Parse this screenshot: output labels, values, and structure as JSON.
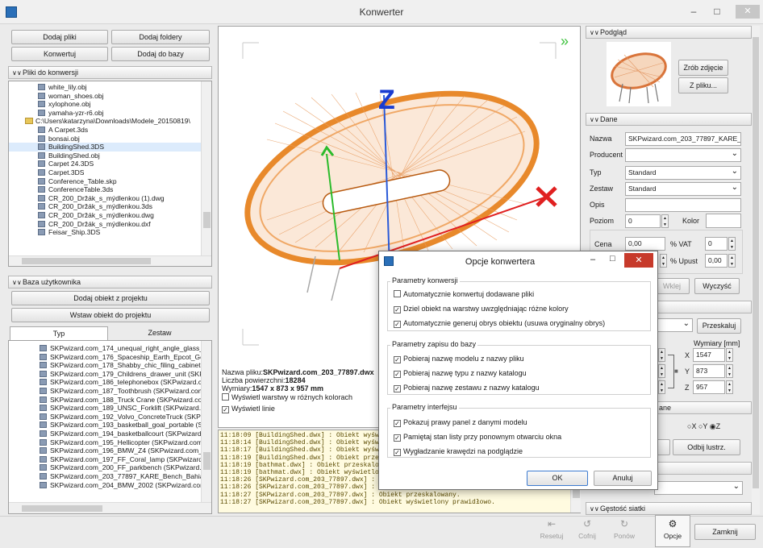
{
  "window": {
    "title": "Konwerter"
  },
  "toolbar_left": {
    "add_files": "Dodaj pliki",
    "add_folders": "Dodaj foldery",
    "convert": "Konwertuj",
    "add_to_db": "Dodaj do bazy"
  },
  "files_section": {
    "title": "Pliki do konwersji",
    "items": [
      {
        "label": "white_lily.obj",
        "folder": false
      },
      {
        "label": "woman_shoes.obj",
        "folder": false
      },
      {
        "label": "xylophone.obj",
        "folder": false
      },
      {
        "label": "yamaha-yzr-r6.obj",
        "folder": false
      },
      {
        "label": "C:\\Users\\katarzyna\\Downloads\\Modele_20150819\\",
        "folder": true
      },
      {
        "label": "A Carpet.3ds",
        "folder": false
      },
      {
        "label": "bonsai.obj",
        "folder": false
      },
      {
        "label": "BuildingShed.3DS",
        "folder": false,
        "selected": true
      },
      {
        "label": "BuildingShed.obj",
        "folder": false
      },
      {
        "label": "Carpet 24.3DS",
        "folder": false
      },
      {
        "label": "Carpet.3DS",
        "folder": false
      },
      {
        "label": "Conference_Table.skp",
        "folder": false
      },
      {
        "label": "ConferenceTable.3ds",
        "folder": false
      },
      {
        "label": "CR_200_Držák_s_mýdlenkou (1).dwg",
        "folder": false
      },
      {
        "label": "CR_200_Držák_s_mýdlenkou.3ds",
        "folder": false
      },
      {
        "label": "CR_200_Držák_s_mýdlenkou.dwg",
        "folder": false
      },
      {
        "label": "CR_200_Držák_s_mýdlenkou.dxf",
        "folder": false
      },
      {
        "label": "Feisar_Ship.3DS",
        "folder": false
      }
    ]
  },
  "user_db": {
    "title": "Baza użytkownika",
    "add_from_project": "Dodaj obiekt z projektu",
    "insert_to_project": "Wstaw obiekt do projektu",
    "tabs": [
      "Typ",
      "Zestaw"
    ],
    "items": [
      "SKPwizard.com_174_unequal_right_angle_glass_tc",
      "SKPwizard.com_176_Spaceship_Earth_Epcot_Geod",
      "SKPwizard.com_178_Shabby_chic_filing_cabinet (S",
      "SKPwizard.com_179_Childrens_drawer_unit (SKPw",
      "SKPwizard.com_186_telephonebox (SKPwizard.cor",
      "SKPwizard.com_187_Toothbrush (SKPwizard.com_",
      "SKPwizard.com_188_Truck Crane (SKPwizard.com_",
      "SKPwizard.com_189_UNSC_Forklift (SKPwizard.cor",
      "SKPwizard.com_192_Volvo_ConcreteTruck (SKPwiz",
      "SKPwizard.com_193_basketball_goal_portable (SKI",
      "SKPwizard.com_194_basketballcourt (SKPwizard.c",
      "SKPwizard.com_195_Hellicopter (SKPwizard.com_1",
      "SKPwizard.com_196_BMW_Z4 (SKPwizard.com_19",
      "SKPwizard.com_197_FF_Coral_lamp (SKPwizard.cc",
      "SKPwizard.com_200_FF_parkbench (SKPwizard.cor",
      "SKPwizard.com_203_77897_KARE_Bench_Bahia_C",
      "SKPwizard.com_204_BMW_2002 (SKPwizard.com"
    ]
  },
  "viewer": {
    "file_label": "Nazwa pliku:",
    "file_value": "SKPwizard.com_203_77897.dwx",
    "faces_label": "Liczba powierzchni:",
    "faces_value": "18284",
    "dims_label": "Wymiary:",
    "dims_value": "1547 x 873 x 957 mm",
    "show_layers": "Wyświetl warstwy w różnych kolorach",
    "show_lines": "Wyświetl linie",
    "axis_z": "Z",
    "expand_glyph": "»"
  },
  "log": [
    "11:18:09 [BuildingShed.dwx] : Obiekt wyświetlony pra",
    "11:18:14 [BuildingShed.dwx] : Obiekt wyświetlony pra",
    "11:18:17 [BuildingShed.dwx] : Obiekt wyświetlony pra",
    "11:18:19 [BuildingShed.dwx] : Obiekt przeskalowany.",
    "11:18:19 [bathmat.dwx] : Obiekt przeskalowany.",
    "11:18:19 [bathmat.dwx] : Obiekt wyświetlony prawid",
    "11:18:26 [SKPwizard.com_203_77897.dwx] : Obiekt",
    "11:18:26 [SKPwizard.com_203_77897.dwx] : Obiekt",
    "11:18:27 [SKPwizard.com_203_77897.dwx] : Obiekt przeskalowany.",
    "11:18:27 [SKPwizard.com_203_77897.dwx] : Obiekt wyświetlony prawidłowo."
  ],
  "right": {
    "preview_title": "Podgląd",
    "take_photo": "Zrób zdjęcie",
    "from_file": "Z pliku...",
    "data_title": "Dane",
    "name_label": "Nazwa",
    "name_value": "SKPwizard.com_203_77897_KARE_Ber",
    "producer_label": "Producent",
    "producer_value": "",
    "type_label": "Typ",
    "type_value": "Standard",
    "set_label": "Zestaw",
    "set_value": "Standard",
    "desc_label": "Opis",
    "desc_value": "",
    "level_label": "Poziom",
    "level_value": "0",
    "color_label": "Kolor",
    "price_label": "Cena",
    "price_value": "0,00",
    "vat_label": "% VAT",
    "vat_value": "0",
    "discount_label": "% Upust",
    "discount_value": "0,00",
    "paste_btn": "Wklej",
    "clear_btn": "Wyczyść",
    "scale_btn": "Przeskaluj",
    "dims_title": "Wymiary [mm]",
    "x_label": "X",
    "x_value": "1547",
    "y_label": "Y",
    "y_value": "873",
    "z_label": "Z",
    "z_value": "957",
    "orient_fragment": "ane",
    "rx": "X",
    "ry": "Y",
    "rz": "Z",
    "mirror_btn": "Odbij lustrz.",
    "density_title": "Gęstość siatki"
  },
  "bottom": {
    "reset": "Resetuj",
    "undo": "Cofnij",
    "redo": "Ponów",
    "options": "Opcje",
    "close": "Zamknij"
  },
  "dialog": {
    "title": "Opcje konwertera",
    "g1_title": "Parametry konwersji",
    "g1": [
      {
        "label": "Automatycznie konwertuj dodawane pliki",
        "checked": false
      },
      {
        "label": "Dziel obiekt na warstwy uwzględniając różne kolory",
        "checked": true
      },
      {
        "label": "Automatycznie generuj obrys obiektu (usuwa oryginalny obrys)",
        "checked": true
      }
    ],
    "g2_title": "Parametry zapisu do bazy",
    "g2": [
      {
        "label": "Pobieraj nazwę modelu z nazwy pliku",
        "checked": true
      },
      {
        "label": "Pobieraj nazwę typu z nazwy katalogu",
        "checked": true
      },
      {
        "label": "Pobieraj nazwę zestawu z nazwy katalogu",
        "checked": true
      }
    ],
    "g3_title": "Parametry interfejsu",
    "g3": [
      {
        "label": "Pokazuj prawy panel z danymi modelu",
        "checked": true
      },
      {
        "label": "Pamiętaj stan listy przy ponownym otwarciu okna",
        "checked": true
      },
      {
        "label": "Wygładzanie krawędzi na podglądzie",
        "checked": true
      }
    ],
    "ok": "OK",
    "cancel": "Anuluj"
  }
}
